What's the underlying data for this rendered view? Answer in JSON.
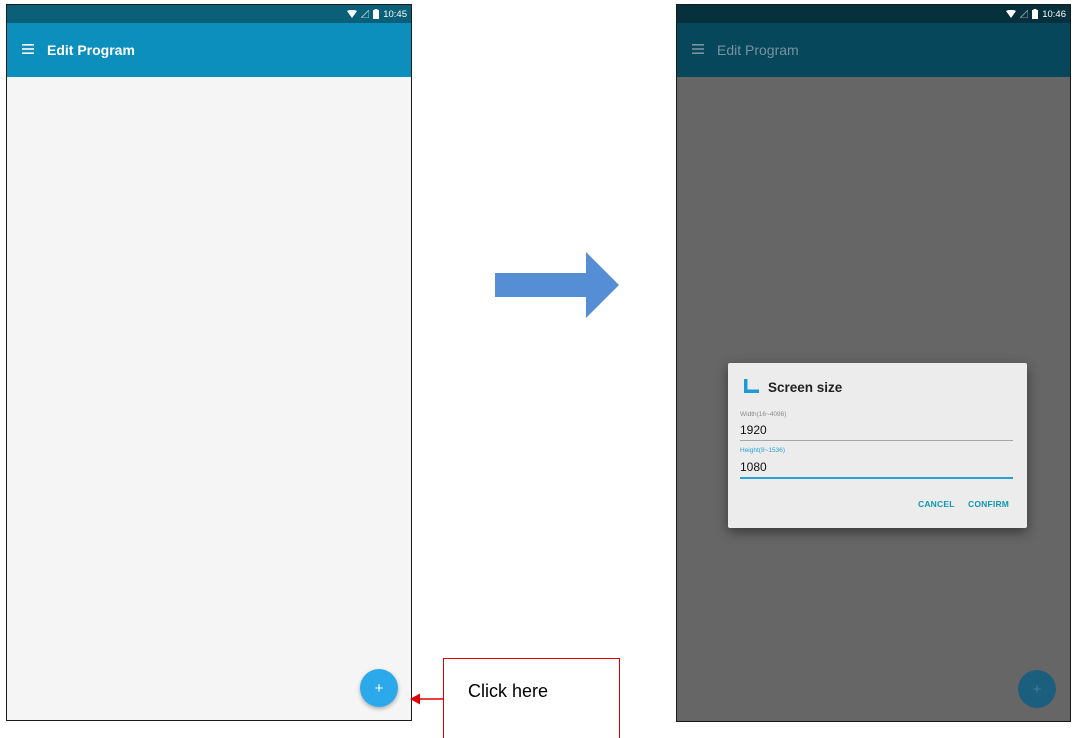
{
  "left_screen": {
    "status_time": "10:45",
    "appbar_title": "Edit Program",
    "fab_label": "+"
  },
  "right_screen": {
    "status_time": "10:46",
    "appbar_title": "Edit Program",
    "fab_label": "+",
    "dialog": {
      "title": "Screen size",
      "width_label": "Width(16~4096)",
      "width_value": "1920",
      "height_label": "Height(8~1536)",
      "height_value": "1080",
      "cancel_label": "CANCEL",
      "confirm_label": "CONFIRM"
    }
  },
  "callout": {
    "text": "Click here"
  },
  "colors": {
    "appbar": "#0c8fbc",
    "statusbar": "#0a6079",
    "fab": "#2ba9eb",
    "dialog_accent": "#29a1d9",
    "dialog_button": "#0e97b4",
    "arrow": "#558ed5",
    "callout_border": "#e00000"
  }
}
